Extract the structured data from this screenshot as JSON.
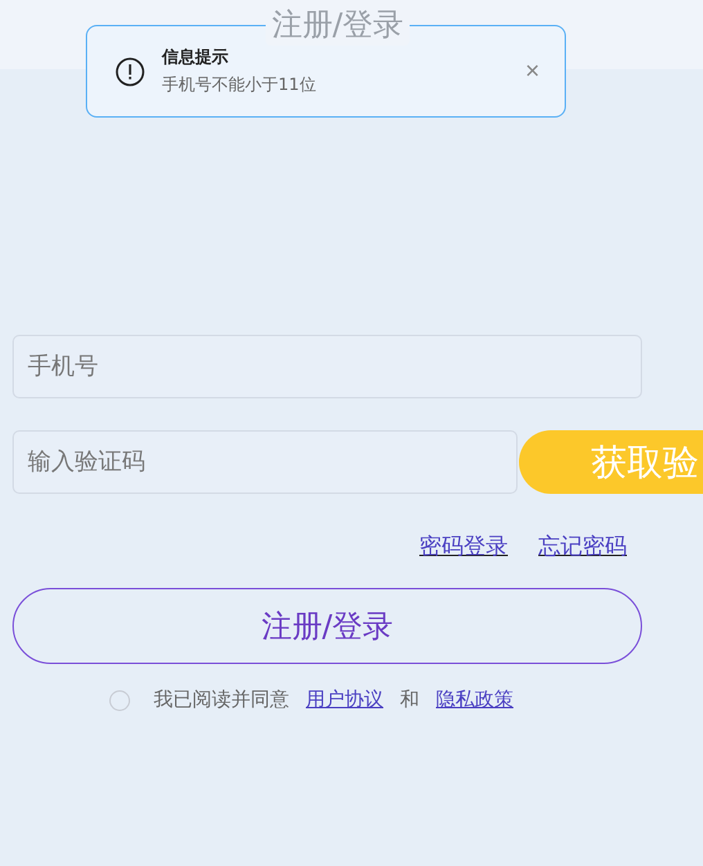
{
  "header": {
    "title": "注册/登录"
  },
  "toast": {
    "title": "信息提示",
    "message": "手机号不能小于11位",
    "close": "×"
  },
  "form": {
    "phone": {
      "placeholder": "手机号"
    },
    "code": {
      "placeholder": "输入验证码"
    },
    "get_code_button": "获取验",
    "links": [
      "密码登录",
      "忘记密码"
    ],
    "submit": "注册/登录",
    "agreement": {
      "checked": false,
      "text": "我已阅读并同意",
      "terms": "用户协议",
      "and": "和",
      "privacy": "隐私政策"
    }
  }
}
